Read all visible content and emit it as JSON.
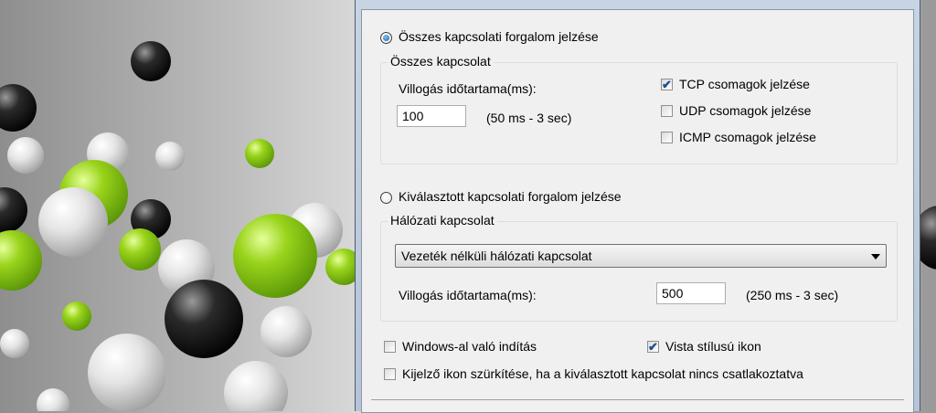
{
  "all_traffic": {
    "radio_label": "Összes kapcsolati forgalom jelzése",
    "group_title": "Összes kapcsolat",
    "duration_label": "Villogás időtartama(ms):",
    "duration_value": "100",
    "duration_hint": "(50 ms - 3 sec)",
    "tcp_label": "TCP csomagok jelzése",
    "udp_label": "UDP csomagok jelzése",
    "icmp_label": "ICMP csomagok jelzése"
  },
  "selected_traffic": {
    "radio_label": "Kiválasztott kapcsolati forgalom jelzése",
    "group_title": "Hálózati kapcsolat",
    "connection_selected": "Vezeték nélküli hálózati kapcsolat",
    "duration_label": "Villogás időtartama(ms):",
    "duration_value": "500",
    "duration_hint": "(250 ms - 3 sec)"
  },
  "options": {
    "start_with_windows": "Windows-al való indítás",
    "vista_icon": "Vista stílusú ikon",
    "gray_icon": "Kijelző ikon szürkítése, ha a kiválasztott kapcsolat nincs csatlakoztatva"
  },
  "state": {
    "all_traffic_selected": true,
    "tcp_checked": true,
    "udp_checked": false,
    "icmp_checked": false,
    "start_with_windows_checked": false,
    "vista_icon_checked": true,
    "gray_icon_checked": false
  },
  "icons": {
    "check": "✔"
  }
}
